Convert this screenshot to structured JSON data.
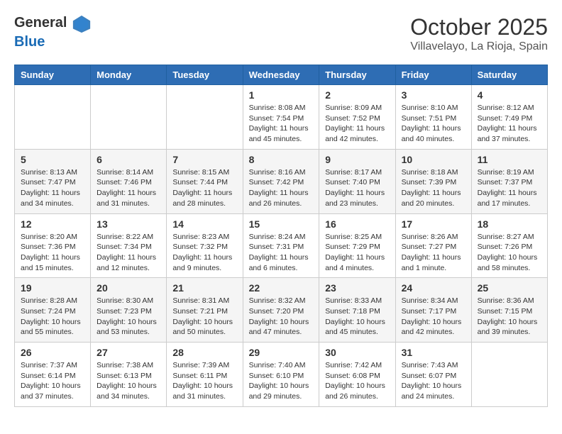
{
  "header": {
    "logo_general": "General",
    "logo_blue": "Blue",
    "month": "October 2025",
    "location": "Villavelayo, La Rioja, Spain"
  },
  "weekdays": [
    "Sunday",
    "Monday",
    "Tuesday",
    "Wednesday",
    "Thursday",
    "Friday",
    "Saturday"
  ],
  "weeks": [
    [
      {
        "day": "",
        "info": ""
      },
      {
        "day": "",
        "info": ""
      },
      {
        "day": "",
        "info": ""
      },
      {
        "day": "1",
        "info": "Sunrise: 8:08 AM\nSunset: 7:54 PM\nDaylight: 11 hours and 45 minutes."
      },
      {
        "day": "2",
        "info": "Sunrise: 8:09 AM\nSunset: 7:52 PM\nDaylight: 11 hours and 42 minutes."
      },
      {
        "day": "3",
        "info": "Sunrise: 8:10 AM\nSunset: 7:51 PM\nDaylight: 11 hours and 40 minutes."
      },
      {
        "day": "4",
        "info": "Sunrise: 8:12 AM\nSunset: 7:49 PM\nDaylight: 11 hours and 37 minutes."
      }
    ],
    [
      {
        "day": "5",
        "info": "Sunrise: 8:13 AM\nSunset: 7:47 PM\nDaylight: 11 hours and 34 minutes."
      },
      {
        "day": "6",
        "info": "Sunrise: 8:14 AM\nSunset: 7:46 PM\nDaylight: 11 hours and 31 minutes."
      },
      {
        "day": "7",
        "info": "Sunrise: 8:15 AM\nSunset: 7:44 PM\nDaylight: 11 hours and 28 minutes."
      },
      {
        "day": "8",
        "info": "Sunrise: 8:16 AM\nSunset: 7:42 PM\nDaylight: 11 hours and 26 minutes."
      },
      {
        "day": "9",
        "info": "Sunrise: 8:17 AM\nSunset: 7:40 PM\nDaylight: 11 hours and 23 minutes."
      },
      {
        "day": "10",
        "info": "Sunrise: 8:18 AM\nSunset: 7:39 PM\nDaylight: 11 hours and 20 minutes."
      },
      {
        "day": "11",
        "info": "Sunrise: 8:19 AM\nSunset: 7:37 PM\nDaylight: 11 hours and 17 minutes."
      }
    ],
    [
      {
        "day": "12",
        "info": "Sunrise: 8:20 AM\nSunset: 7:36 PM\nDaylight: 11 hours and 15 minutes."
      },
      {
        "day": "13",
        "info": "Sunrise: 8:22 AM\nSunset: 7:34 PM\nDaylight: 11 hours and 12 minutes."
      },
      {
        "day": "14",
        "info": "Sunrise: 8:23 AM\nSunset: 7:32 PM\nDaylight: 11 hours and 9 minutes."
      },
      {
        "day": "15",
        "info": "Sunrise: 8:24 AM\nSunset: 7:31 PM\nDaylight: 11 hours and 6 minutes."
      },
      {
        "day": "16",
        "info": "Sunrise: 8:25 AM\nSunset: 7:29 PM\nDaylight: 11 hours and 4 minutes."
      },
      {
        "day": "17",
        "info": "Sunrise: 8:26 AM\nSunset: 7:27 PM\nDaylight: 11 hours and 1 minute."
      },
      {
        "day": "18",
        "info": "Sunrise: 8:27 AM\nSunset: 7:26 PM\nDaylight: 10 hours and 58 minutes."
      }
    ],
    [
      {
        "day": "19",
        "info": "Sunrise: 8:28 AM\nSunset: 7:24 PM\nDaylight: 10 hours and 55 minutes."
      },
      {
        "day": "20",
        "info": "Sunrise: 8:30 AM\nSunset: 7:23 PM\nDaylight: 10 hours and 53 minutes."
      },
      {
        "day": "21",
        "info": "Sunrise: 8:31 AM\nSunset: 7:21 PM\nDaylight: 10 hours and 50 minutes."
      },
      {
        "day": "22",
        "info": "Sunrise: 8:32 AM\nSunset: 7:20 PM\nDaylight: 10 hours and 47 minutes."
      },
      {
        "day": "23",
        "info": "Sunrise: 8:33 AM\nSunset: 7:18 PM\nDaylight: 10 hours and 45 minutes."
      },
      {
        "day": "24",
        "info": "Sunrise: 8:34 AM\nSunset: 7:17 PM\nDaylight: 10 hours and 42 minutes."
      },
      {
        "day": "25",
        "info": "Sunrise: 8:36 AM\nSunset: 7:15 PM\nDaylight: 10 hours and 39 minutes."
      }
    ],
    [
      {
        "day": "26",
        "info": "Sunrise: 7:37 AM\nSunset: 6:14 PM\nDaylight: 10 hours and 37 minutes."
      },
      {
        "day": "27",
        "info": "Sunrise: 7:38 AM\nSunset: 6:13 PM\nDaylight: 10 hours and 34 minutes."
      },
      {
        "day": "28",
        "info": "Sunrise: 7:39 AM\nSunset: 6:11 PM\nDaylight: 10 hours and 31 minutes."
      },
      {
        "day": "29",
        "info": "Sunrise: 7:40 AM\nSunset: 6:10 PM\nDaylight: 10 hours and 29 minutes."
      },
      {
        "day": "30",
        "info": "Sunrise: 7:42 AM\nSunset: 6:08 PM\nDaylight: 10 hours and 26 minutes."
      },
      {
        "day": "31",
        "info": "Sunrise: 7:43 AM\nSunset: 6:07 PM\nDaylight: 10 hours and 24 minutes."
      },
      {
        "day": "",
        "info": ""
      }
    ]
  ]
}
